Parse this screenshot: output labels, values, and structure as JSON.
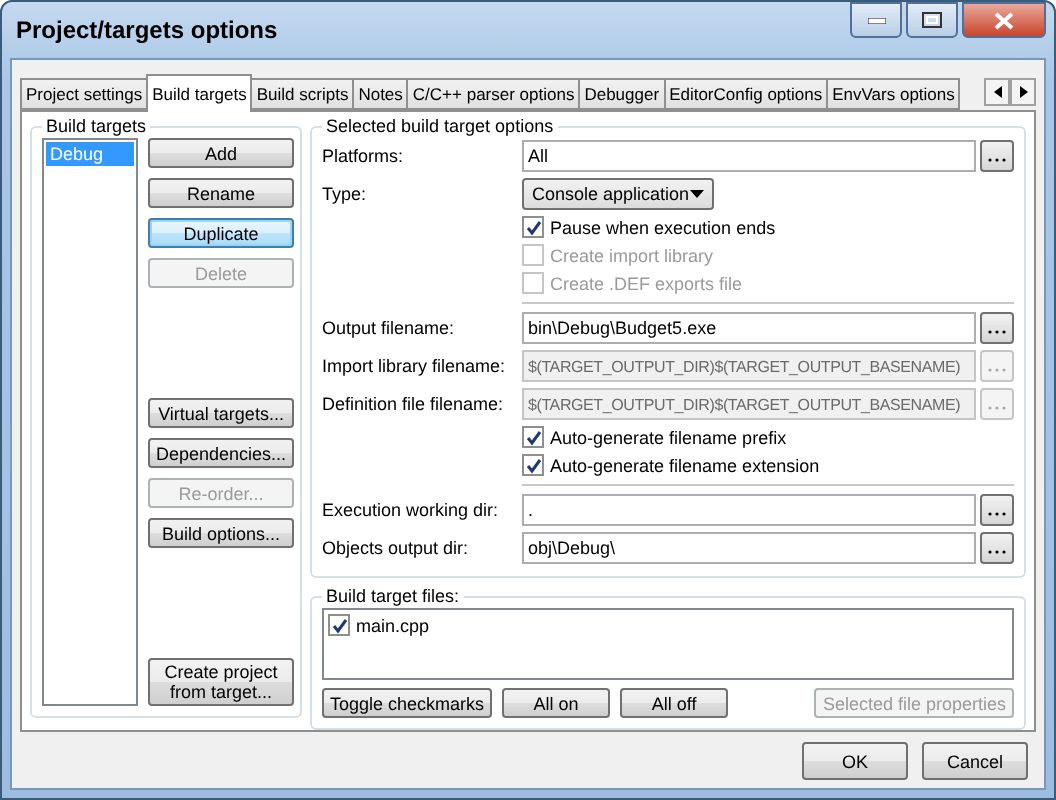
{
  "window": {
    "title": "Project/targets options"
  },
  "tabs": [
    {
      "label": "Project settings",
      "selected": false
    },
    {
      "label": "Build targets",
      "selected": true
    },
    {
      "label": "Build scripts",
      "selected": false
    },
    {
      "label": "Notes",
      "selected": false
    },
    {
      "label": "C/C++ parser options",
      "selected": false
    },
    {
      "label": "Debugger",
      "selected": false
    },
    {
      "label": "EditorConfig options",
      "selected": false
    },
    {
      "label": "EnvVars options",
      "selected": false
    }
  ],
  "build_targets": {
    "title": "Build targets",
    "targets": [
      {
        "label": "Debug",
        "selected": true
      }
    ],
    "buttons_top": [
      {
        "label": "Add",
        "disabled": false,
        "focused": false
      },
      {
        "label": "Rename",
        "disabled": false,
        "focused": false
      },
      {
        "label": "Duplicate",
        "disabled": false,
        "focused": true
      },
      {
        "label": "Delete",
        "disabled": true,
        "focused": false
      }
    ],
    "buttons_middle": [
      {
        "label": "Virtual targets...",
        "disabled": false,
        "focused": false
      },
      {
        "label": "Dependencies...",
        "disabled": false,
        "focused": false
      },
      {
        "label": "Re-order...",
        "disabled": true,
        "focused": false
      },
      {
        "label": "Build options...",
        "disabled": false,
        "focused": false
      }
    ],
    "buttons_bottom": [
      {
        "label": "Create project from target...",
        "disabled": false,
        "focused": false
      }
    ]
  },
  "options": {
    "title": "Selected build target options",
    "platforms": {
      "label": "Platforms:",
      "value": "All"
    },
    "type": {
      "label": "Type:",
      "value": "Console application"
    },
    "type_checks": [
      {
        "label": "Pause when execution ends",
        "checked": true,
        "disabled": false
      },
      {
        "label": "Create import library",
        "checked": false,
        "disabled": true
      },
      {
        "label": "Create .DEF exports file",
        "checked": false,
        "disabled": true
      }
    ],
    "paths": [
      {
        "label": "Output filename:",
        "value": "bin\\Debug\\Budget5.exe",
        "disabled": false
      },
      {
        "label": "Import library filename:",
        "value": "$(TARGET_OUTPUT_DIR)$(TARGET_OUTPUT_BASENAME)",
        "disabled": true
      },
      {
        "label": "Definition file filename:",
        "value": "$(TARGET_OUTPUT_DIR)$(TARGET_OUTPUT_BASENAME)",
        "disabled": true
      }
    ],
    "name_checks": [
      {
        "label": "Auto-generate filename prefix",
        "checked": true,
        "disabled": false
      },
      {
        "label": "Auto-generate filename extension",
        "checked": true,
        "disabled": false
      }
    ],
    "dirs": [
      {
        "label": "Execution working dir:",
        "value": ".",
        "disabled": false
      },
      {
        "label": "Objects output dir:",
        "value": "obj\\Debug\\",
        "disabled": false
      }
    ]
  },
  "files": {
    "title": "Build target files:",
    "items": [
      {
        "label": "main.cpp",
        "checked": true
      }
    ],
    "buttons": [
      {
        "label": "Toggle checkmarks",
        "disabled": false
      },
      {
        "label": "All on",
        "disabled": false
      },
      {
        "label": "All off",
        "disabled": false
      },
      {
        "label": "Selected file properties",
        "disabled": true
      }
    ]
  },
  "dialog_buttons": [
    {
      "label": "OK"
    },
    {
      "label": "Cancel"
    }
  ]
}
